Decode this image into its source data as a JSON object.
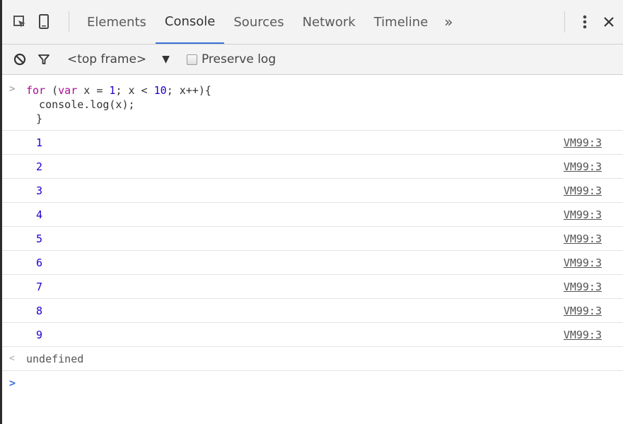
{
  "tabs": [
    {
      "label": "Elements"
    },
    {
      "label": "Console"
    },
    {
      "label": "Sources"
    },
    {
      "label": "Network"
    },
    {
      "label": "Timeline"
    }
  ],
  "tabs_more": "»",
  "icons": {
    "inspect": "inspect-element-icon",
    "device": "device-mode-icon",
    "menu": "kebab-menu-icon",
    "close": "close-icon",
    "clear": "clear-console-icon",
    "filter": "filter-icon"
  },
  "toolbar": {
    "frame": "<top frame>",
    "frame_arrow": "▼",
    "preserve_log": "Preserve log"
  },
  "input": {
    "prompt": ">",
    "line1_kw1": "for",
    "line1_a": " (",
    "line1_kw2": "var",
    "line1_b": " x = ",
    "line1_n1": "1",
    "line1_c": "; x < ",
    "line1_n2": "10",
    "line1_d": "; x++){",
    "line2": "  console.log(x);",
    "line3": "}"
  },
  "logs": [
    {
      "value": "1",
      "source": "VM99:3"
    },
    {
      "value": "2",
      "source": "VM99:3"
    },
    {
      "value": "3",
      "source": "VM99:3"
    },
    {
      "value": "4",
      "source": "VM99:3"
    },
    {
      "value": "5",
      "source": "VM99:3"
    },
    {
      "value": "6",
      "source": "VM99:3"
    },
    {
      "value": "7",
      "source": "VM99:3"
    },
    {
      "value": "8",
      "source": "VM99:3"
    },
    {
      "value": "9",
      "source": "VM99:3"
    }
  ],
  "result": {
    "arrow": "<",
    "value": "undefined"
  },
  "prompt_caret": ">",
  "colors": {
    "accent": "#3a73d8",
    "keyword": "#aa0d91",
    "number": "#1c00cf"
  }
}
